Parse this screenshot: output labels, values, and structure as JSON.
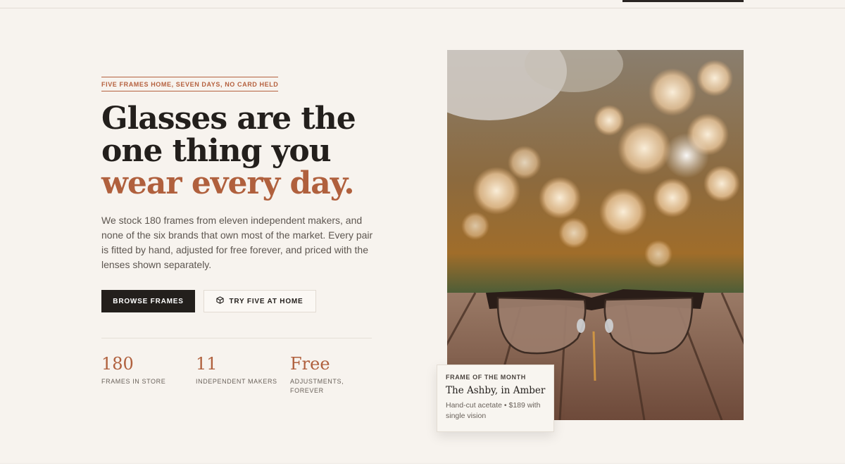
{
  "hero": {
    "eyebrow": "FIVE FRAMES HOME, SEVEN DAYS, NO CARD HELD",
    "headline_line1": "Glasses are the",
    "headline_line2": "one thing you",
    "headline_accent": "wear every day.",
    "lede": "We stock 180 frames from eleven independent makers, and none of the six brands that own most of the market. Every pair is fitted by hand, adjusted for free forever, and priced with the lenses shown separately.",
    "primary_button": "BROWSE FRAMES",
    "secondary_button": "TRY FIVE AT HOME",
    "secondary_button_icon": "box-icon"
  },
  "stats": [
    {
      "value": "180",
      "label": "FRAMES IN STORE"
    },
    {
      "value": "11",
      "label": "INDEPENDENT MAKERS"
    },
    {
      "value": "Free",
      "label": "ADJUSTMENTS, FOREVER"
    }
  ],
  "feature_card": {
    "kicker": "FRAME OF THE MONTH",
    "title": "The Ashby, in Amber",
    "description": "Hand-cut acetate • $189 with single vision"
  },
  "colors": {
    "background": "#f7f3ee",
    "accent": "#b0603d",
    "dark": "#231f1c"
  }
}
